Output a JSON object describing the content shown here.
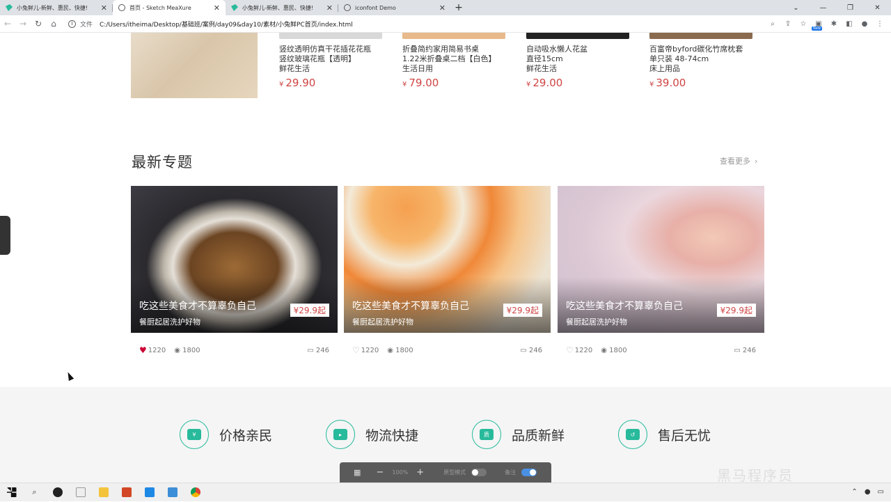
{
  "browser": {
    "tabs": [
      {
        "title": "小兔鲜儿-新鲜、惠民、快捷!",
        "active": false,
        "icon": "rabbit-icon"
      },
      {
        "title": "首页 - Sketch MeaXure",
        "active": true,
        "icon": "globe-icon"
      },
      {
        "title": "小兔鲜儿-新鲜、惠民、快捷!",
        "active": false,
        "icon": "rabbit-icon"
      },
      {
        "title": "iconfont Demo",
        "active": false,
        "icon": "globe-icon"
      }
    ],
    "address_label": "文件",
    "url": "C:/Users/itheima/Desktop/基础班/案例/day09&day10/素材/小兔鲜PC首页/index.html",
    "new_badge": "New"
  },
  "products": [
    {
      "name": "竖纹透明仿真干花插花花瓶\n竖纹玻璃花瓶【透明】\n鲜花生活",
      "currency": "¥",
      "price": "29.90",
      "color": "#d8d8d8"
    },
    {
      "name": "折叠简约家用简易书桌\n1.22米折叠桌二档【白色】\n生活日用",
      "currency": "¥",
      "price": "79.00",
      "color": "#e8b98a"
    },
    {
      "name": "自动吸水懒人花盆\n直径15cm\n鲜花生活",
      "currency": "¥",
      "price": "29.00",
      "color": "#222222"
    },
    {
      "name": "百富帝byford碳化竹席枕套\n单只装 48-74cm\n床上用品",
      "currency": "¥",
      "price": "39.00",
      "color": "#8a6a4e"
    }
  ],
  "section": {
    "title": "最新专题",
    "more": "查看更多"
  },
  "topics": [
    {
      "title": "吃这些美食才不算辜负自己",
      "subtitle": "餐厨起居洗护好物",
      "tag": "¥29.9起",
      "likes": "1220",
      "views": "1800",
      "comments": "246",
      "liked": true
    },
    {
      "title": "吃这些美食才不算辜负自己",
      "subtitle": "餐厨起居洗护好物",
      "tag": "¥29.9起",
      "likes": "1220",
      "views": "1800",
      "comments": "246",
      "liked": false
    },
    {
      "title": "吃这些美食才不算辜负自己",
      "subtitle": "餐厨起居洗护好物",
      "tag": "¥29.9起",
      "likes": "1220",
      "views": "1800",
      "comments": "246",
      "liked": false
    }
  ],
  "features": [
    {
      "label": "价格亲民",
      "icon": "price-icon"
    },
    {
      "label": "物流快捷",
      "icon": "truck-icon"
    },
    {
      "label": "品质新鲜",
      "icon": "quality-icon"
    },
    {
      "label": "售后无忧",
      "icon": "aftersale-icon"
    }
  ],
  "axure_bar": {
    "zoom": "100%",
    "mode_label": "原型模式",
    "notes_label": "备注"
  },
  "watermark": "黑马程序员",
  "colors": {
    "accent": "#27ba9b",
    "price": "#cf4444"
  }
}
